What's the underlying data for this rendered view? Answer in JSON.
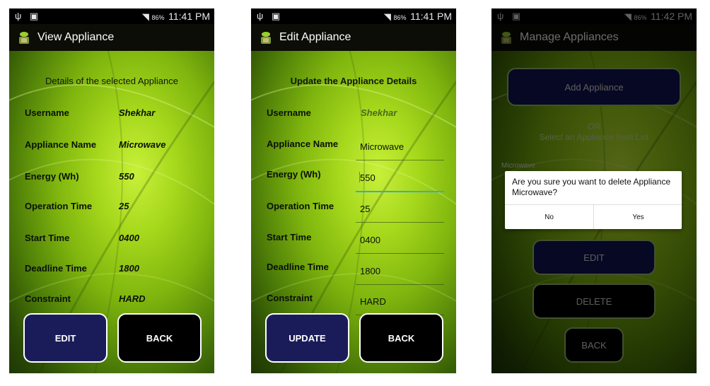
{
  "statusbar": {
    "left_icons": "ψ ▣",
    "battery": "86%",
    "screens_time": [
      "11:41 PM",
      "11:41 PM",
      "11:42 PM"
    ]
  },
  "view": {
    "title": "View Appliance",
    "heading": "Details of the selected Appliance",
    "rows": [
      {
        "label": "Username",
        "value": "Shekhar"
      },
      {
        "label": "Appliance Name",
        "value": "Microwave"
      },
      {
        "label": "Energy (Wh)",
        "value": "550"
      },
      {
        "label": "Operation Time",
        "value": "25"
      },
      {
        "label": "Start Time",
        "value": "0400"
      },
      {
        "label": "Deadline Time",
        "value": "1800"
      },
      {
        "label": "Constraint",
        "value": "HARD"
      }
    ],
    "edit_button": "EDIT",
    "back_button": "BACK"
  },
  "edit": {
    "title": "Edit Appliance",
    "heading": "Update the Appliance Details",
    "rows": [
      {
        "label": "Username",
        "value": "Shekhar"
      },
      {
        "label": "Appliance Name",
        "value": "Microwave"
      },
      {
        "label": "Energy (Wh)",
        "value": "550"
      },
      {
        "label": "Operation Time",
        "value": "25"
      },
      {
        "label": "Start Time",
        "value": "0400"
      },
      {
        "label": "Deadline Time",
        "value": "1800"
      },
      {
        "label": "Constraint",
        "value": "HARD"
      }
    ],
    "update_button": "UPDATE",
    "back_button": "BACK"
  },
  "manage": {
    "title": "Manage Appliances",
    "add_button": "Add Appliance",
    "or_text": "OR",
    "select_text": "Select an Appliance from List",
    "list_item": "Microwave",
    "dialog": {
      "message": "Are you sure you want to delete Appliance Microwave?",
      "no": "No",
      "yes": "Yes"
    },
    "edit_button": "EDIT",
    "delete_button": "DELETE",
    "back_button": "BACK"
  },
  "colors": {
    "navy_button": "#1a1c5a",
    "black_button": "#000000",
    "focus_line": "#39a9d6"
  }
}
